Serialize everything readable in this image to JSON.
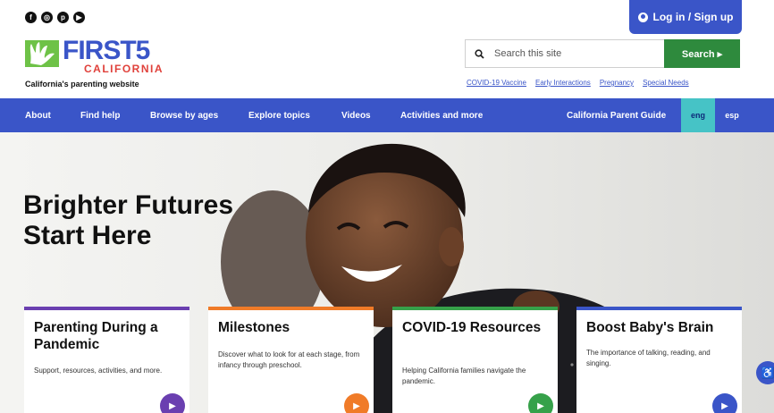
{
  "header": {
    "social_icons": [
      "facebook-icon",
      "instagram-icon",
      "pinterest-icon",
      "youtube-icon"
    ],
    "login_label": "Log in / Sign up",
    "logo": {
      "brand": "FIRST5",
      "region": "CALIFORNIA",
      "tagline": "California's parenting website"
    },
    "search": {
      "placeholder": "Search this site",
      "button_label": "Search ▸"
    },
    "quick_links": [
      "COVID-19 Vaccine",
      "Early Interactions",
      "Pregnancy",
      "Special Needs"
    ]
  },
  "nav": {
    "items": [
      "About",
      "Find help",
      "Browse by ages",
      "Explore topics",
      "Videos",
      "Activities and more",
      "California Parent Guide"
    ],
    "languages": [
      "eng",
      "esp"
    ],
    "active_language": "eng"
  },
  "hero": {
    "headline_line1": "Brighter Futures",
    "headline_line2": "Start Here"
  },
  "cards": [
    {
      "title": "Parenting During a Pandemic",
      "text": "Support, resources, activities, and more.",
      "color": "#6a3fb0"
    },
    {
      "title": "Milestones",
      "text": "Discover what to look for at each stage, from infancy through preschool.",
      "color": "#f07b28"
    },
    {
      "title": "COVID-19 Resources",
      "text": "Helping California families navigate the pandemic.",
      "color": "#36a14a"
    },
    {
      "title": "Boost Baby's Brain",
      "text": "The importance of talking, reading, and singing.",
      "color": "#3a55c8"
    }
  ],
  "colors": {
    "primary_blue": "#3a55c8",
    "search_green": "#2e8a3d",
    "eng_teal": "#46c3c6",
    "logo_red": "#e0413b"
  }
}
